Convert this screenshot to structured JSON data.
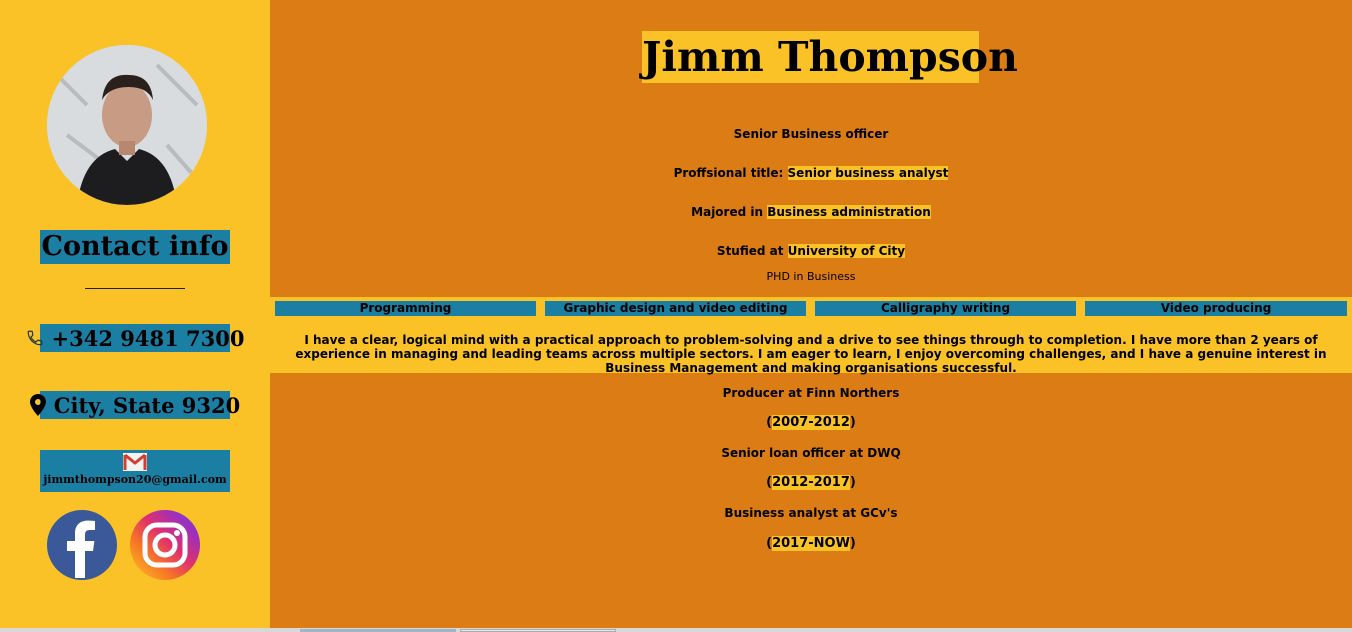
{
  "profile": {
    "name": "Jimm Thompson",
    "headline": "Senior Business officer",
    "title_label": "Proffsional title:",
    "title_value": "Senior business analyst",
    "major_label": "Majored in",
    "major_value": "Business administration",
    "studied_label": "Stufied at",
    "studied_value": "University of City",
    "degree": "PHD in Business"
  },
  "contact": {
    "heading": "Contact info",
    "divider": "________________",
    "phone": "+342 9481 7300",
    "location": "City, State 9320",
    "email": "jimmthompson20@gmail.com",
    "icons": [
      "phone-icon",
      "location-pin-icon",
      "mail-icon",
      "facebook-icon",
      "instagram-icon"
    ]
  },
  "skills": [
    "Programming",
    "Graphic design and video editing",
    "Calligraphy writing",
    "Video producing"
  ],
  "about": "I have a clear, logical mind with a practical approach to problem-solving and a drive to see things through to completion. I have more than 2 years of experience in managing and leading teams across multiple sectors. I am eager to learn, I enjoy overcoming challenges, and I have a genuine interest in Business Management and making organisations successful.",
  "experience": [
    {
      "role": "Producer at Finn Northers",
      "years": "2007-2012"
    },
    {
      "role": "Senior loan officer at DWQ",
      "years": "2012-2017"
    },
    {
      "role": "Business analyst at GCv's",
      "years": "2017-NOW"
    }
  ],
  "colors": {
    "sidebar": "#fbc228",
    "main": "#dc7c14",
    "accent": "#1b7fa3",
    "highlight": "#fbc228"
  }
}
